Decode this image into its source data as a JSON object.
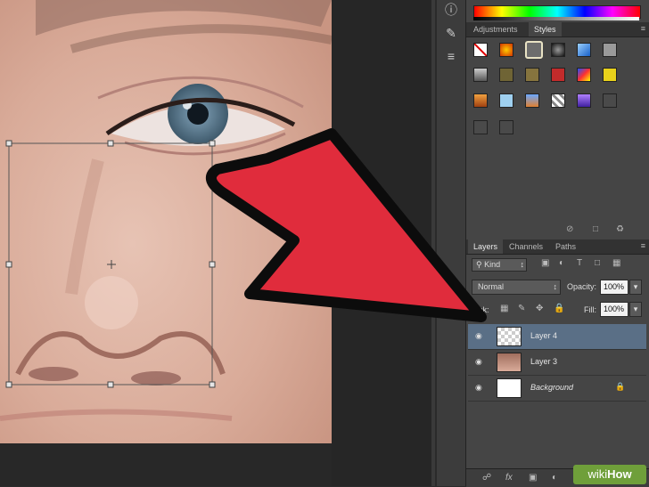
{
  "panels": {
    "adjustments_tab": "Adjustments",
    "styles_tab": "Styles",
    "layers_tab": "Layers",
    "channels_tab": "Channels",
    "paths_tab": "Paths",
    "kind_label": "Kind",
    "blend_mode": "Normal",
    "opacity_label": "Opacity:",
    "opacity_value": "100%",
    "lock_label": "ck:",
    "fill_label": "Fill:",
    "fill_value": "100%"
  },
  "layers": [
    {
      "name": "Layer 4",
      "selected": true
    },
    {
      "name": "Layer 3",
      "selected": false
    },
    {
      "name": "Background",
      "selected": false
    }
  ],
  "watermark": {
    "wiki": "wiki",
    "how": "How"
  },
  "colors": {
    "arrow_fill": "#e02c3c",
    "selection_row": "#5a6f86"
  }
}
